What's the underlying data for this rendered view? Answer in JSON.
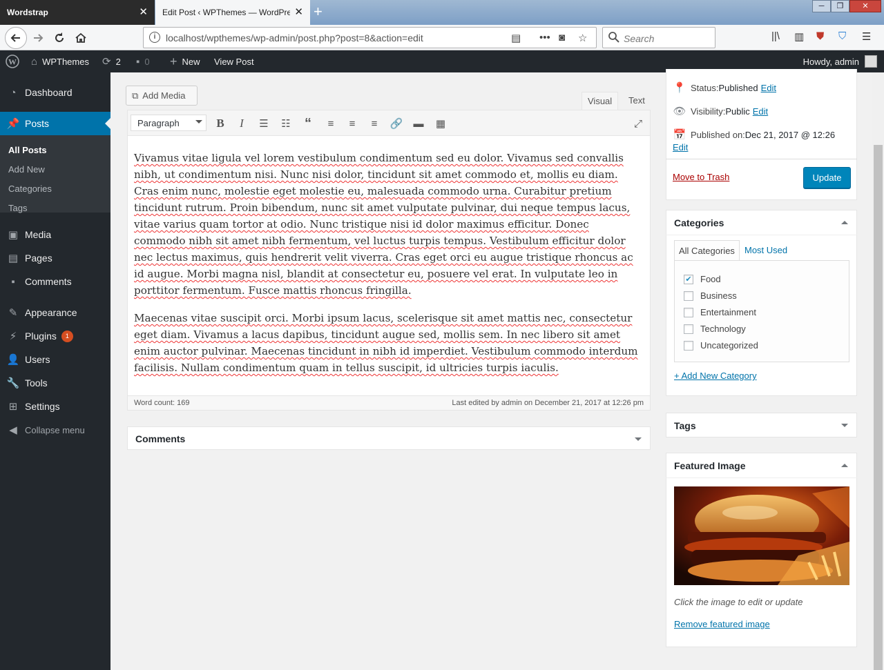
{
  "browser": {
    "tabs": [
      {
        "label": "Wordstrap"
      },
      {
        "label": "Edit Post ‹ WPThemes — WordPress"
      }
    ],
    "url": "localhost/wpthemes/wp-admin/post.php?post=8&action=edit",
    "search_placeholder": "Search"
  },
  "adminbar": {
    "site_name": "WPThemes",
    "updates_count": "2",
    "comments_count": "0",
    "new_label": "New",
    "view_post": "View Post",
    "howdy": "Howdy, admin"
  },
  "menu": {
    "dashboard": "Dashboard",
    "posts": "Posts",
    "posts_sub": [
      "All Posts",
      "Add New",
      "Categories",
      "Tags"
    ],
    "media": "Media",
    "pages": "Pages",
    "comments": "Comments",
    "appearance": "Appearance",
    "plugins": "Plugins",
    "plugins_badge": "1",
    "users": "Users",
    "tools": "Tools",
    "settings": "Settings",
    "collapse": "Collapse menu"
  },
  "editor": {
    "add_media": "Add Media",
    "tab_visual": "Visual",
    "tab_text": "Text",
    "format": "Paragraph",
    "paragraphs": [
      "Vivamus vitae ligula vel lorem vestibulum condimentum sed eu dolor. Vivamus sed convallis nibh, ut condimentum nisi. Nunc nisi dolor, tincidunt sit amet commodo et, mollis eu diam. Cras enim nunc, molestie eget molestie eu, malesuada commodo urna. Curabitur pretium tincidunt rutrum. Proin bibendum, nunc sit amet vulputate pulvinar, dui neque tempus lacus, vitae varius quam tortor at odio. Nunc tristique nisi id dolor maximus efficitur. Donec commodo nibh sit amet nibh fermentum, vel luctus turpis tempus. Vestibulum efficitur dolor nec lectus maximus, quis hendrerit velit viverra. Cras eget orci eu augue tristique rhoncus ac id augue. Morbi magna nisl, blandit at consectetur eu, posuere vel erat. In vulputate leo in porttitor fermentum. Fusce mattis rhoncus fringilla.",
      "Maecenas vitae suscipit orci. Morbi ipsum lacus, scelerisque sit amet mattis nec, consectetur eget diam. Vivamus a lacus dapibus, tincidunt augue sed, mollis sem. In nec libero sit amet enim auctor pulvinar. Maecenas tincidunt in nibh id imperdiet. Vestibulum commodo interdum facilisis. Nullam condimentum quam in tellus suscipit, id ultricies turpis iaculis."
    ],
    "word_count": "Word count: 169",
    "last_edited": "Last edited by admin on December 21, 2017 at 12:26 pm"
  },
  "comments_box": {
    "title": "Comments"
  },
  "publish": {
    "status_label": "Status: ",
    "status_value": "Published",
    "visibility_label": "Visibility: ",
    "visibility_value": "Public",
    "published_on": "Published on: ",
    "published_date": "Dec 21, 2017 @ 12:26",
    "edit": "Edit",
    "trash": "Move to Trash",
    "update": "Update"
  },
  "categories": {
    "title": "Categories",
    "tab_all": "All Categories",
    "tab_most_used": "Most Used",
    "items": [
      {
        "label": "Food",
        "checked": true
      },
      {
        "label": "Business",
        "checked": false
      },
      {
        "label": "Entertainment",
        "checked": false
      },
      {
        "label": "Technology",
        "checked": false
      },
      {
        "label": "Uncategorized",
        "checked": false
      }
    ],
    "add_new": "+ Add New Category"
  },
  "tags": {
    "title": "Tags"
  },
  "featured": {
    "title": "Featured Image",
    "hint": "Click the image to edit or update",
    "remove": "Remove featured image"
  },
  "colors": {
    "wp_blue": "#0073aa",
    "admin_dark": "#23282d",
    "update_button": "#0085ba",
    "trash_red": "#a00"
  }
}
